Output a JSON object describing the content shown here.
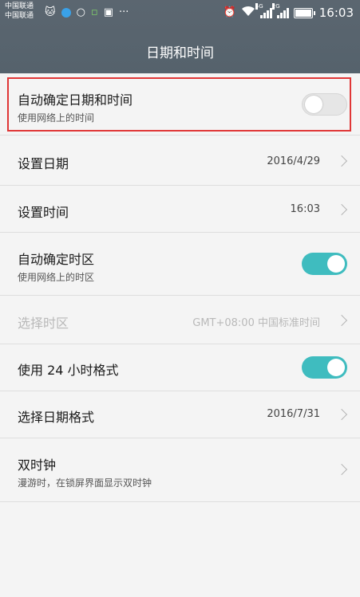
{
  "status_bar": {
    "carrier_1": "中国联通",
    "carrier_2": "中国联通",
    "more": "···",
    "net_4g": "4G",
    "net_2g": "2G",
    "time": "16:03"
  },
  "header": {
    "title": "日期和时间"
  },
  "settings": {
    "auto_datetime": {
      "title": "自动确定日期和时间",
      "subtitle": "使用网络上的时间",
      "enabled": false
    },
    "set_date": {
      "title": "设置日期",
      "value": "2016/4/29"
    },
    "set_time": {
      "title": "设置时间",
      "value": "16:03"
    },
    "auto_timezone": {
      "title": "自动确定时区",
      "subtitle": "使用网络上的时区",
      "enabled": true
    },
    "select_timezone": {
      "title": "选择时区",
      "value": "GMT+08:00 中国标准时间"
    },
    "use_24h": {
      "title": "使用 24 小时格式",
      "enabled": true
    },
    "date_format": {
      "title": "选择日期格式",
      "value": "2016/7/31"
    },
    "dual_clock": {
      "title": "双时钟",
      "subtitle": "漫游时，在锁屏界面显示双时钟"
    }
  },
  "colors": {
    "header": "#55626c",
    "accent": "#3fbcbf",
    "highlight": "#e03636"
  }
}
